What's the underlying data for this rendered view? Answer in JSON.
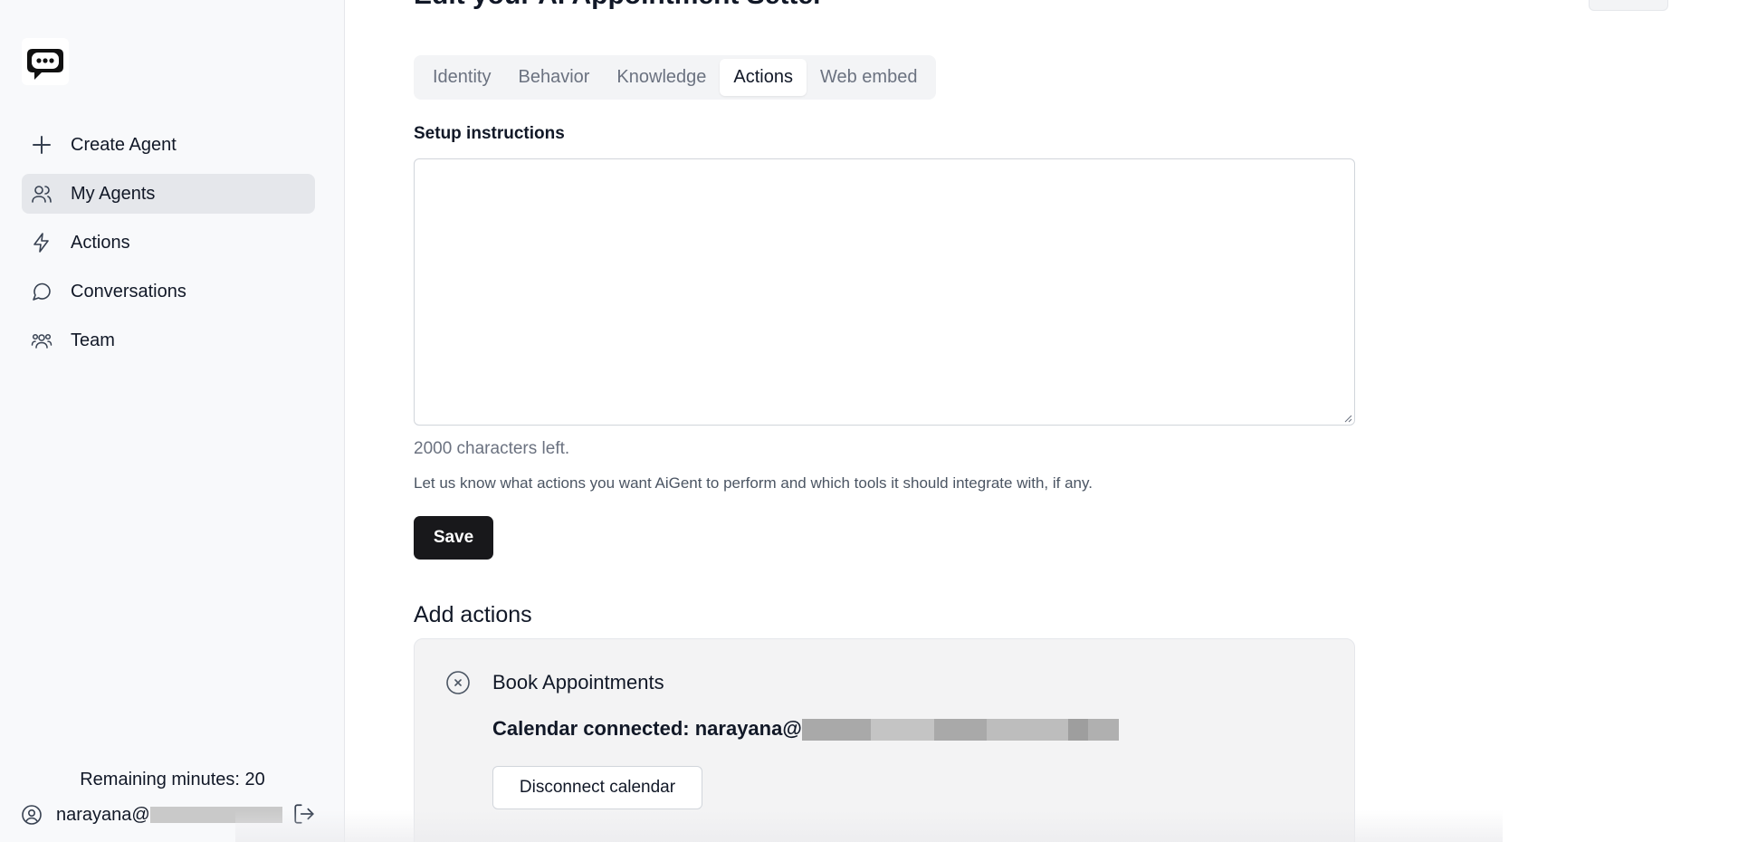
{
  "page": {
    "title": "Edit your AI Appointment Setter"
  },
  "sidebar": {
    "logo_icon": "chat-bubble-logo-icon",
    "items": [
      {
        "label": "Create Agent",
        "icon": "plus-icon",
        "active": false
      },
      {
        "label": "My Agents",
        "icon": "users-icon",
        "active": true
      },
      {
        "label": "Actions",
        "icon": "lightning-icon",
        "active": false
      },
      {
        "label": "Conversations",
        "icon": "message-circle-icon",
        "active": false
      },
      {
        "label": "Team",
        "icon": "team-icon",
        "active": false
      }
    ],
    "remaining_minutes": "Remaining minutes: 20",
    "user_email": "narayana@",
    "logout_icon": "logout-icon"
  },
  "tabs": [
    {
      "label": "Identity",
      "active": false
    },
    {
      "label": "Behavior",
      "active": false
    },
    {
      "label": "Knowledge",
      "active": false
    },
    {
      "label": "Actions",
      "active": true
    },
    {
      "label": "Web embed",
      "active": false
    }
  ],
  "setup": {
    "label": "Setup instructions",
    "value": "",
    "chars_left": "2000 characters left.",
    "help_text": "Let us know what actions you want AiGent to perform and which tools it should integrate with, if any.",
    "save_label": "Save"
  },
  "add_actions": {
    "title": "Add actions",
    "card": {
      "icon": "x-circle-icon",
      "title": "Book Appointments",
      "calendar_text": "Calendar connected: narayana@",
      "disconnect_label": "Disconnect calendar"
    }
  },
  "colors": {
    "sidebar_bg": "#f8f9fb",
    "active_nav_bg": "#e5e7eb",
    "primary_button": "#18181b",
    "card_bg": "#f3f3f4"
  }
}
